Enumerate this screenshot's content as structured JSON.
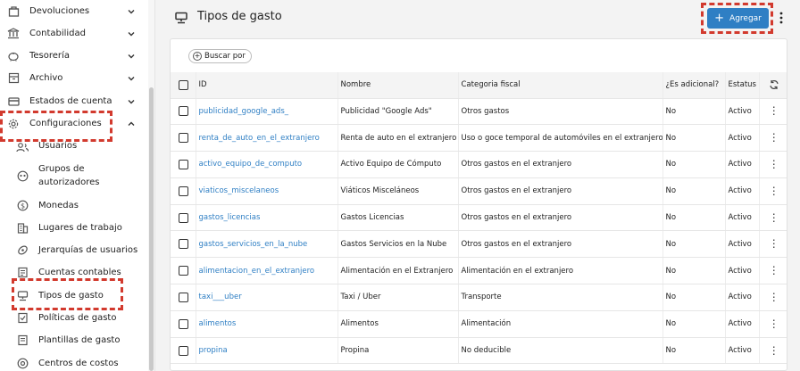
{
  "sidebar": {
    "items": [
      {
        "label": "Devoluciones",
        "icon": "returns-icon"
      },
      {
        "label": "Contabilidad",
        "icon": "bank-icon"
      },
      {
        "label": "Tesorería",
        "icon": "piggy-bank-icon"
      },
      {
        "label": "Archivo",
        "icon": "archive-icon"
      },
      {
        "label": "Estados de cuenta",
        "icon": "statement-icon"
      },
      {
        "label": "Configuraciones",
        "icon": "gear-icon"
      }
    ],
    "sub_items": [
      {
        "label": "Usuarios",
        "icon": "users-icon"
      },
      {
        "label": "Grupos de autorizadores",
        "icon": "group-icon"
      },
      {
        "label": "Monedas",
        "icon": "currency-icon"
      },
      {
        "label": "Lugares de trabajo",
        "icon": "building-icon"
      },
      {
        "label": "Jerarquías de usuarios",
        "icon": "hierarchy-icon"
      },
      {
        "label": "Cuentas contables",
        "icon": "ledger-icon"
      },
      {
        "label": "Tipos de gasto",
        "icon": "register-icon"
      },
      {
        "label": "Políticas de gasto",
        "icon": "policy-icon"
      },
      {
        "label": "Plantillas de gasto",
        "icon": "template-icon"
      },
      {
        "label": "Centros de costos",
        "icon": "cost-center-icon"
      }
    ]
  },
  "header": {
    "title": "Tipos de gasto",
    "add_label": "Agregar"
  },
  "search": {
    "label": "Buscar por"
  },
  "table": {
    "columns": [
      "ID",
      "Nombre",
      "Categoria fiscal",
      "¿Es adicional?",
      "Estatus"
    ],
    "rows": [
      {
        "id": "publicidad_google_ads_",
        "nombre": "Publicidad \"Google Ads\"",
        "categoria": "Otros gastos",
        "adicional": "No",
        "estatus": "Activo"
      },
      {
        "id": "renta_de_auto_en_el_extranjero",
        "nombre": "Renta de auto en el extranjero",
        "categoria": "Uso o goce temporal de automóviles en el extranjero",
        "adicional": "No",
        "estatus": "Activo"
      },
      {
        "id": "activo_equipo_de_computo",
        "nombre": "Activo Equipo de Cómputo",
        "categoria": "Otros gastos en el extranjero",
        "adicional": "No",
        "estatus": "Activo"
      },
      {
        "id": "viaticos_miscelaneos",
        "nombre": "Viáticos Misceláneos",
        "categoria": "Otros gastos en el extranjero",
        "adicional": "No",
        "estatus": "Activo"
      },
      {
        "id": "gastos_licencias",
        "nombre": "Gastos Licencias",
        "categoria": "Otros gastos en el extranjero",
        "adicional": "No",
        "estatus": "Activo"
      },
      {
        "id": "gastos_servicios_en_la_nube",
        "nombre": "Gastos Servicios en la Nube",
        "categoria": "Otros gastos en el extranjero",
        "adicional": "No",
        "estatus": "Activo"
      },
      {
        "id": "alimentacion_en_el_extranjero",
        "nombre": "Alimentación en el Extranjero",
        "categoria": "Alimentación en el extranjero",
        "adicional": "No",
        "estatus": "Activo"
      },
      {
        "id": "taxi___uber",
        "nombre": "Taxi / Uber",
        "categoria": "Transporte",
        "adicional": "No",
        "estatus": "Activo"
      },
      {
        "id": "alimentos",
        "nombre": "Alimentos",
        "categoria": "Alimentación",
        "adicional": "No",
        "estatus": "Activo"
      },
      {
        "id": "propina",
        "nombre": "Propina",
        "categoria": "No deducible",
        "adicional": "No",
        "estatus": "Activo"
      }
    ]
  },
  "colors": {
    "accent": "#2f7fc4",
    "highlight": "#d23a2e"
  }
}
